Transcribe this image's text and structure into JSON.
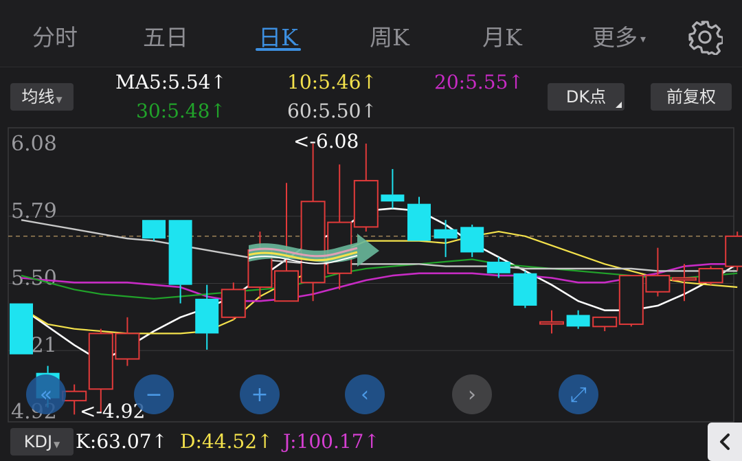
{
  "tabs": [
    {
      "label": "分时",
      "active": false
    },
    {
      "label": "五日",
      "active": false
    },
    {
      "label": "日K",
      "active": true
    },
    {
      "label": "周K",
      "active": false
    },
    {
      "label": "月K",
      "active": false
    },
    {
      "label": "更多",
      "active": false
    }
  ],
  "more_caret": "▾",
  "ma": {
    "toggle_label": "均线",
    "ma5": "MA5:5.54↑",
    "ma10": "10:5.46↑",
    "ma20": "20:5.55↑",
    "ma30": "30:5.48↑",
    "ma60": "60:5.50↑",
    "dk_label": "DK点",
    "fq_label": "前复权"
  },
  "colors": {
    "ma5": "#ffffff",
    "ma10": "#f4e24c",
    "ma20": "#c72bc4",
    "ma30": "#21a32a",
    "ma60": "#c9c9c9",
    "up": "#e23a3a",
    "down": "#1ee3f0",
    "grid": "#3a3a3c",
    "active_tab": "#3d8fe0"
  },
  "chart_data": {
    "type": "candlestick",
    "y_ticks": [
      "6.08",
      "5.79",
      "5.50",
      "5.21",
      "4.92"
    ],
    "y_tick_values": [
      6.08,
      5.79,
      5.5,
      5.21,
      4.92
    ],
    "ylim": [
      4.92,
      6.08
    ],
    "last_price_line": 5.68,
    "max_annotation": "<-6.08",
    "min_annotation": "<-4.92",
    "max_value": 6.08,
    "min_value": 4.92,
    "candles": [
      {
        "o": 5.39,
        "c": 5.17,
        "h": 5.39,
        "l": 5.17
      },
      {
        "o": 5.09,
        "c": 4.98,
        "h": 5.12,
        "l": 4.94
      },
      {
        "o": 4.97,
        "c": 5.01,
        "h": 5.04,
        "l": 4.91
      },
      {
        "o": 5.02,
        "c": 5.26,
        "h": 5.28,
        "l": 4.92
      },
      {
        "o": 5.15,
        "c": 5.26,
        "h": 5.33,
        "l": 5.12
      },
      {
        "o": 5.75,
        "c": 5.67,
        "h": 5.75,
        "l": 5.66
      },
      {
        "o": 5.75,
        "c": 5.47,
        "h": 5.75,
        "l": 5.39
      },
      {
        "o": 5.41,
        "c": 5.26,
        "h": 5.47,
        "l": 5.19
      },
      {
        "o": 5.33,
        "c": 5.45,
        "h": 5.48,
        "l": 5.32
      },
      {
        "o": 5.46,
        "c": 5.62,
        "h": 5.7,
        "l": 5.41
      },
      {
        "o": 5.4,
        "c": 5.53,
        "h": 5.91,
        "l": 5.4
      },
      {
        "o": 5.48,
        "c": 5.83,
        "h": 6.08,
        "l": 5.4
      },
      {
        "o": 5.52,
        "c": 5.74,
        "h": 5.99,
        "l": 5.45
      },
      {
        "o": 5.72,
        "c": 5.92,
        "h": 6.08,
        "l": 5.7
      },
      {
        "o": 5.86,
        "c": 5.83,
        "h": 5.97,
        "l": 5.8
      },
      {
        "o": 5.82,
        "c": 5.66,
        "h": 5.85,
        "l": 5.66
      },
      {
        "o": 5.71,
        "c": 5.67,
        "h": 5.75,
        "l": 5.59
      },
      {
        "o": 5.72,
        "c": 5.61,
        "h": 5.73,
        "l": 5.59
      },
      {
        "o": 5.57,
        "c": 5.52,
        "h": 5.59,
        "l": 5.5
      },
      {
        "o": 5.52,
        "c": 5.38,
        "h": 5.53,
        "l": 5.37
      },
      {
        "o": 5.31,
        "c": 5.31,
        "h": 5.36,
        "l": 5.26
      },
      {
        "o": 5.34,
        "c": 5.29,
        "h": 5.36,
        "l": 5.28
      },
      {
        "o": 5.29,
        "c": 5.33,
        "h": 5.33,
        "l": 5.27
      },
      {
        "o": 5.3,
        "c": 5.51,
        "h": 5.51,
        "l": 5.29
      },
      {
        "o": 5.44,
        "c": 5.51,
        "h": 5.63,
        "l": 5.42
      },
      {
        "o": 5.5,
        "c": 5.5,
        "h": 5.56,
        "l": 5.4
      },
      {
        "o": 5.48,
        "c": 5.54,
        "h": 5.55,
        "l": 5.47
      },
      {
        "o": 5.55,
        "c": 5.68,
        "h": 5.7,
        "l": 5.53
      }
    ],
    "series": [
      {
        "key": "ma5",
        "values": [
          5.37,
          5.29,
          5.21,
          5.14,
          5.2,
          5.27,
          5.33,
          5.37,
          5.42,
          5.5,
          5.58,
          5.66,
          5.7,
          5.79,
          5.8,
          5.79,
          5.73,
          5.65,
          5.59,
          5.53,
          5.47,
          5.4,
          5.36,
          5.36,
          5.38,
          5.43,
          5.49,
          5.56
        ]
      },
      {
        "key": "ma10",
        "values": [
          5.37,
          5.3,
          5.28,
          5.27,
          5.26,
          5.26,
          5.26,
          5.27,
          5.32,
          5.42,
          5.48,
          5.53,
          5.61,
          5.66,
          5.66,
          5.66,
          5.65,
          5.68,
          5.7,
          5.68,
          5.64,
          5.6,
          5.56,
          5.53,
          5.5,
          5.48,
          5.47,
          5.46
        ]
      },
      {
        "key": "ma20",
        "values": [
          5.5,
          5.49,
          5.48,
          5.48,
          5.48,
          5.47,
          5.46,
          5.42,
          5.4,
          5.4,
          5.41,
          5.43,
          5.46,
          5.49,
          5.51,
          5.52,
          5.52,
          5.52,
          5.51,
          5.51,
          5.5,
          5.48,
          5.48,
          5.5,
          5.52,
          5.55,
          5.56,
          5.56
        ]
      },
      {
        "key": "ma30",
        "values": [
          5.51,
          5.48,
          5.45,
          5.43,
          5.42,
          5.41,
          5.42,
          5.43,
          5.44,
          5.45,
          5.46,
          5.49,
          5.52,
          5.54,
          5.55,
          5.56,
          5.57,
          5.58,
          5.56,
          5.55,
          5.54,
          5.53,
          5.52,
          5.51,
          5.5,
          5.5,
          5.51,
          5.52
        ]
      },
      {
        "key": "ma60",
        "values": [
          5.75,
          5.73,
          5.71,
          5.69,
          5.67,
          5.66,
          5.64,
          5.62,
          5.6,
          5.58,
          5.57,
          5.56,
          5.56,
          5.56,
          5.56,
          5.56,
          5.55,
          5.55,
          5.55,
          5.54,
          5.54,
          5.54,
          5.54,
          5.54,
          5.53,
          5.53,
          5.53,
          5.53
        ]
      }
    ]
  },
  "controls": [
    {
      "icon": "double-chevron-left-icon",
      "glyph": "«",
      "active": true
    },
    {
      "icon": "zoom-out-icon",
      "glyph": "−",
      "active": true
    },
    {
      "icon": "zoom-in-icon",
      "glyph": "+",
      "active": true
    },
    {
      "icon": "chevron-left-icon",
      "glyph": "‹",
      "active": true
    },
    {
      "icon": "chevron-right-icon",
      "glyph": "›",
      "active": false
    },
    {
      "icon": "expand-icon",
      "glyph": "⤢",
      "active": true
    }
  ],
  "kdj": {
    "toggle_label": "KDJ",
    "k": "K:63.07↑",
    "d": "D:44.52↑",
    "j": "J:100.17↑"
  }
}
